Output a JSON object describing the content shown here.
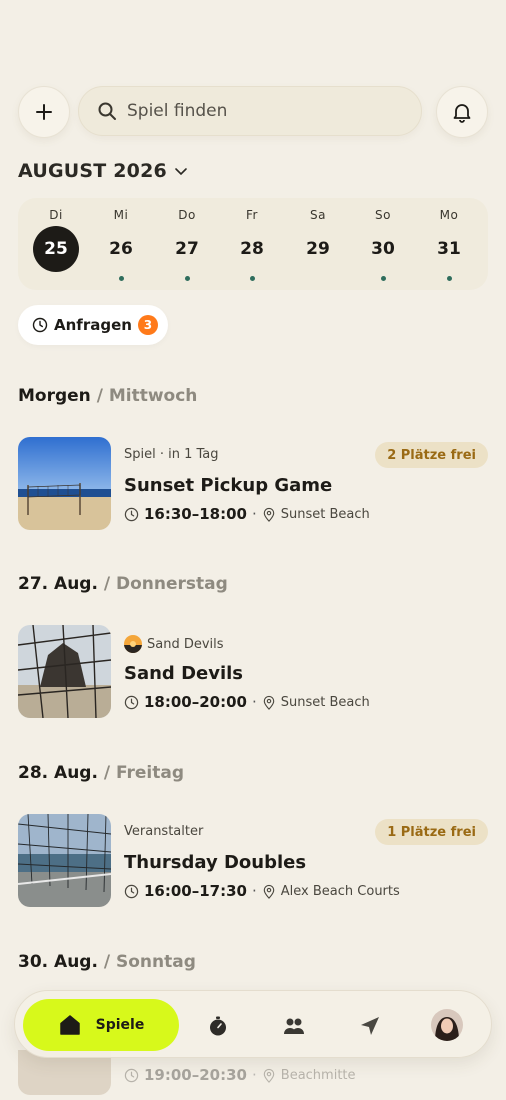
{
  "search": {
    "placeholder": "Spiel finden"
  },
  "calendar": {
    "month": "AUGUST 2026",
    "days": [
      {
        "dn": "Di",
        "num": "25",
        "selected": true,
        "dot": false
      },
      {
        "dn": "Mi",
        "num": "26",
        "selected": false,
        "dot": true
      },
      {
        "dn": "Do",
        "num": "27",
        "selected": false,
        "dot": true
      },
      {
        "dn": "Fr",
        "num": "28",
        "selected": false,
        "dot": true
      },
      {
        "dn": "Sa",
        "num": "29",
        "selected": false,
        "dot": false
      },
      {
        "dn": "So",
        "num": "30",
        "selected": false,
        "dot": true
      },
      {
        "dn": "Mo",
        "num": "31",
        "selected": false,
        "dot": true
      }
    ]
  },
  "requests": {
    "label": "Anfragen",
    "count": "3"
  },
  "sections": [
    {
      "title": "Morgen",
      "sub": " / Mittwoch"
    },
    {
      "title": "27. Aug.",
      "sub": " / Donnerstag"
    },
    {
      "title": "28. Aug.",
      "sub": " / Freitag"
    },
    {
      "title": "30. Aug.",
      "sub": " / Sonntag"
    }
  ],
  "events": [
    {
      "meta": "Spiel · in 1 Tag",
      "title": "Sunset Pickup Game",
      "time": "16:30–18:00",
      "location": "Sunset Beach",
      "free": "2 Plätze frei"
    },
    {
      "meta": "Sand Devils",
      "title": "Sand Devils",
      "time": "18:00–20:00",
      "location": "Sunset Beach",
      "free": ""
    },
    {
      "meta": "Veranstalter",
      "title": "Thursday Doubles",
      "time": "16:00–17:30",
      "location": "Alex Beach Courts",
      "free": "1 Plätze frei"
    },
    {
      "meta": "",
      "title": "",
      "time": "19:00–20:30",
      "location": "Beachmitte",
      "free": ""
    }
  ],
  "nav": {
    "home_label": "Spiele"
  },
  "colors": {
    "accent": "#d7f91b",
    "background": "#f3efe6",
    "badge": "#ff7a1a",
    "dot": "#2f6d5c"
  }
}
